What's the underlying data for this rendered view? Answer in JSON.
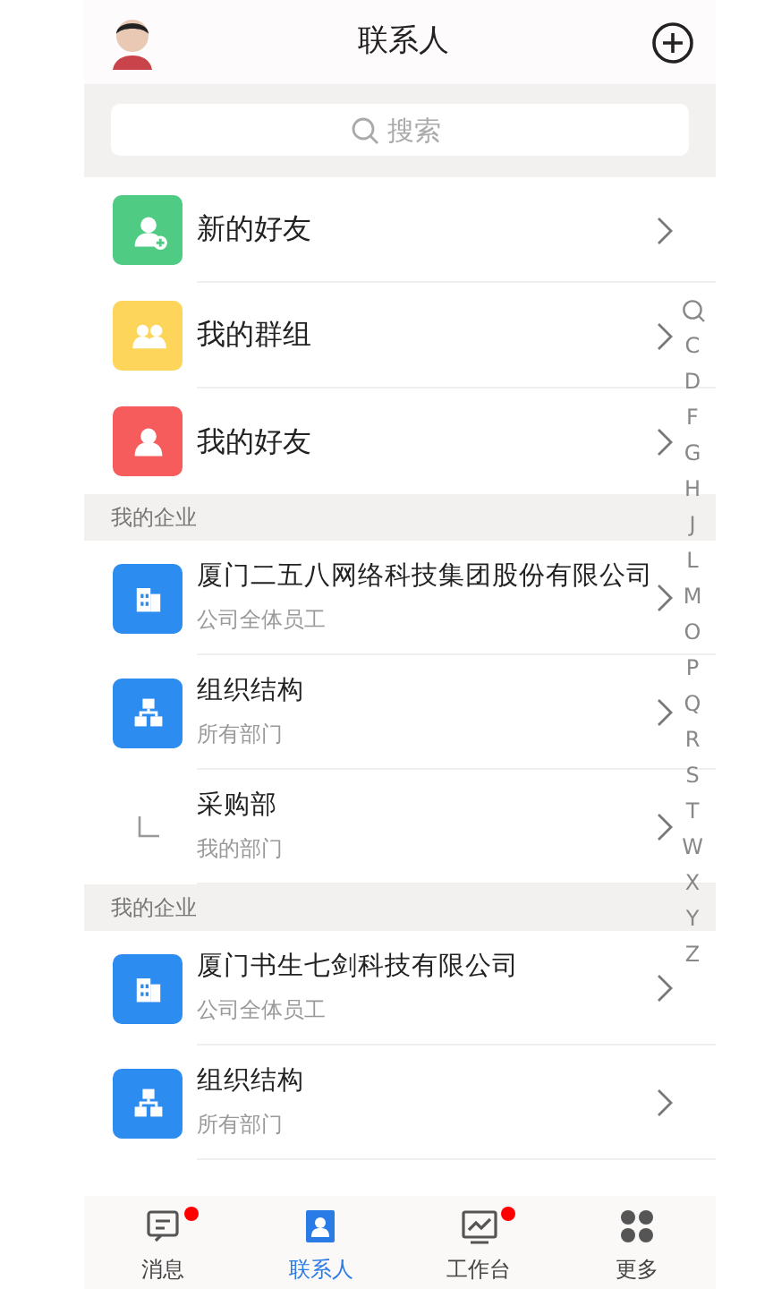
{
  "header": {
    "title": "联系人"
  },
  "search": {
    "placeholder": "搜索"
  },
  "quick_items": [
    {
      "kind": "new-friend",
      "label": "新的好友"
    },
    {
      "kind": "group",
      "label": "我的群组"
    },
    {
      "kind": "friend",
      "label": "我的好友"
    }
  ],
  "sections": [
    {
      "title": "我的企业",
      "items": [
        {
          "kind": "company",
          "title": "厦门二五八网络科技集团股份有限公司",
          "subtitle": "公司全体员工"
        },
        {
          "kind": "org",
          "title": "组织结构",
          "subtitle": "所有部门"
        },
        {
          "kind": "dept",
          "title": "采购部",
          "subtitle": "我的部门"
        }
      ]
    },
    {
      "title": "我的企业",
      "items": [
        {
          "kind": "company",
          "title": "厦门书生七剑科技有限公司",
          "subtitle": "公司全体员工"
        },
        {
          "kind": "org",
          "title": "组织结构",
          "subtitle": "所有部门"
        }
      ]
    }
  ],
  "index_letters": [
    "C",
    "D",
    "F",
    "G",
    "H",
    "J",
    "L",
    "M",
    "O",
    "P",
    "Q",
    "R",
    "S",
    "T",
    "W",
    "X",
    "Y",
    "Z"
  ],
  "tabs": [
    {
      "kind": "message",
      "label": "消息",
      "selected": false,
      "badge": true
    },
    {
      "kind": "contacts",
      "label": "联系人",
      "selected": true,
      "badge": false
    },
    {
      "kind": "workbench",
      "label": "工作台",
      "selected": false,
      "badge": true
    },
    {
      "kind": "more",
      "label": "更多",
      "selected": false,
      "badge": false
    }
  ]
}
